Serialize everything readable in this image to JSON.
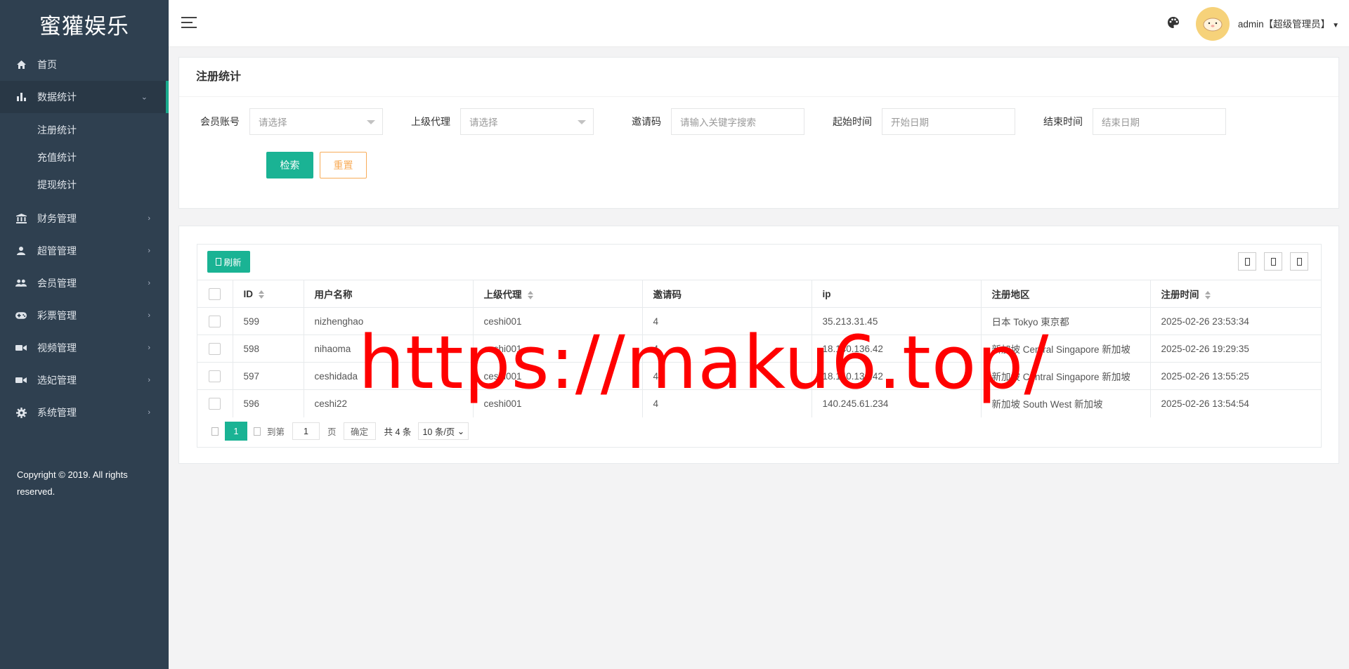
{
  "sidebar": {
    "logo": "蜜獾娱乐",
    "home": "首页",
    "data_stats": "数据统计",
    "sub_items": [
      "注册统计",
      "充值统计",
      "提现统计"
    ],
    "menus": [
      "财务管理",
      "超管管理",
      "会员管理",
      "彩票管理",
      "视频管理",
      "选妃管理",
      "系统管理"
    ],
    "copyright": "Copyright © 2019. All rights reserved."
  },
  "header": {
    "user": "admin【超级管理员】"
  },
  "search": {
    "title": "注册统计",
    "member_label": "会员账号",
    "member_value": "请选择",
    "agent_label": "上级代理",
    "agent_value": "请选择",
    "invite_label": "邀请码",
    "invite_placeholder": "请输入关键字搜索",
    "start_label": "起始时间",
    "start_placeholder": "开始日期",
    "end_label": "结束时间",
    "end_placeholder": "结束日期",
    "search_btn": "检索",
    "reset_btn": "重置"
  },
  "table": {
    "refresh": "刷新",
    "columns": [
      "ID",
      "用户名称",
      "上级代理",
      "邀请码",
      "ip",
      "注册地区",
      "注册时间"
    ],
    "rows": [
      {
        "id": "599",
        "name": "nizhenghao",
        "agent": "ceshi001",
        "code": "4",
        "ip": "35.213.31.45",
        "region": "日本 Tokyo 東京都",
        "time": "2025-02-26 23:53:34"
      },
      {
        "id": "598",
        "name": "nihaoma",
        "agent": "ceshi001",
        "code": "4",
        "ip": "18.140.136.42",
        "region": "新加坡 Central Singapore 新加坡",
        "time": "2025-02-26 19:29:35"
      },
      {
        "id": "597",
        "name": "ceshidada",
        "agent": "ceshi001",
        "code": "4",
        "ip": "18.140.136.42",
        "region": "新加坡 Central Singapore 新加坡",
        "time": "2025-02-26 13:55:25"
      },
      {
        "id": "596",
        "name": "ceshi22",
        "agent": "ceshi001",
        "code": "4",
        "ip": "140.245.61.234",
        "region": "新加坡 South West 新加坡",
        "time": "2025-02-26 13:54:54"
      }
    ]
  },
  "pager": {
    "current": "1",
    "goto": "到第",
    "page_input": "1",
    "page_unit": "页",
    "confirm": "确定",
    "total": "共 4 条",
    "per_page": "10 条/页"
  },
  "watermark": "https://maku6.top/"
}
